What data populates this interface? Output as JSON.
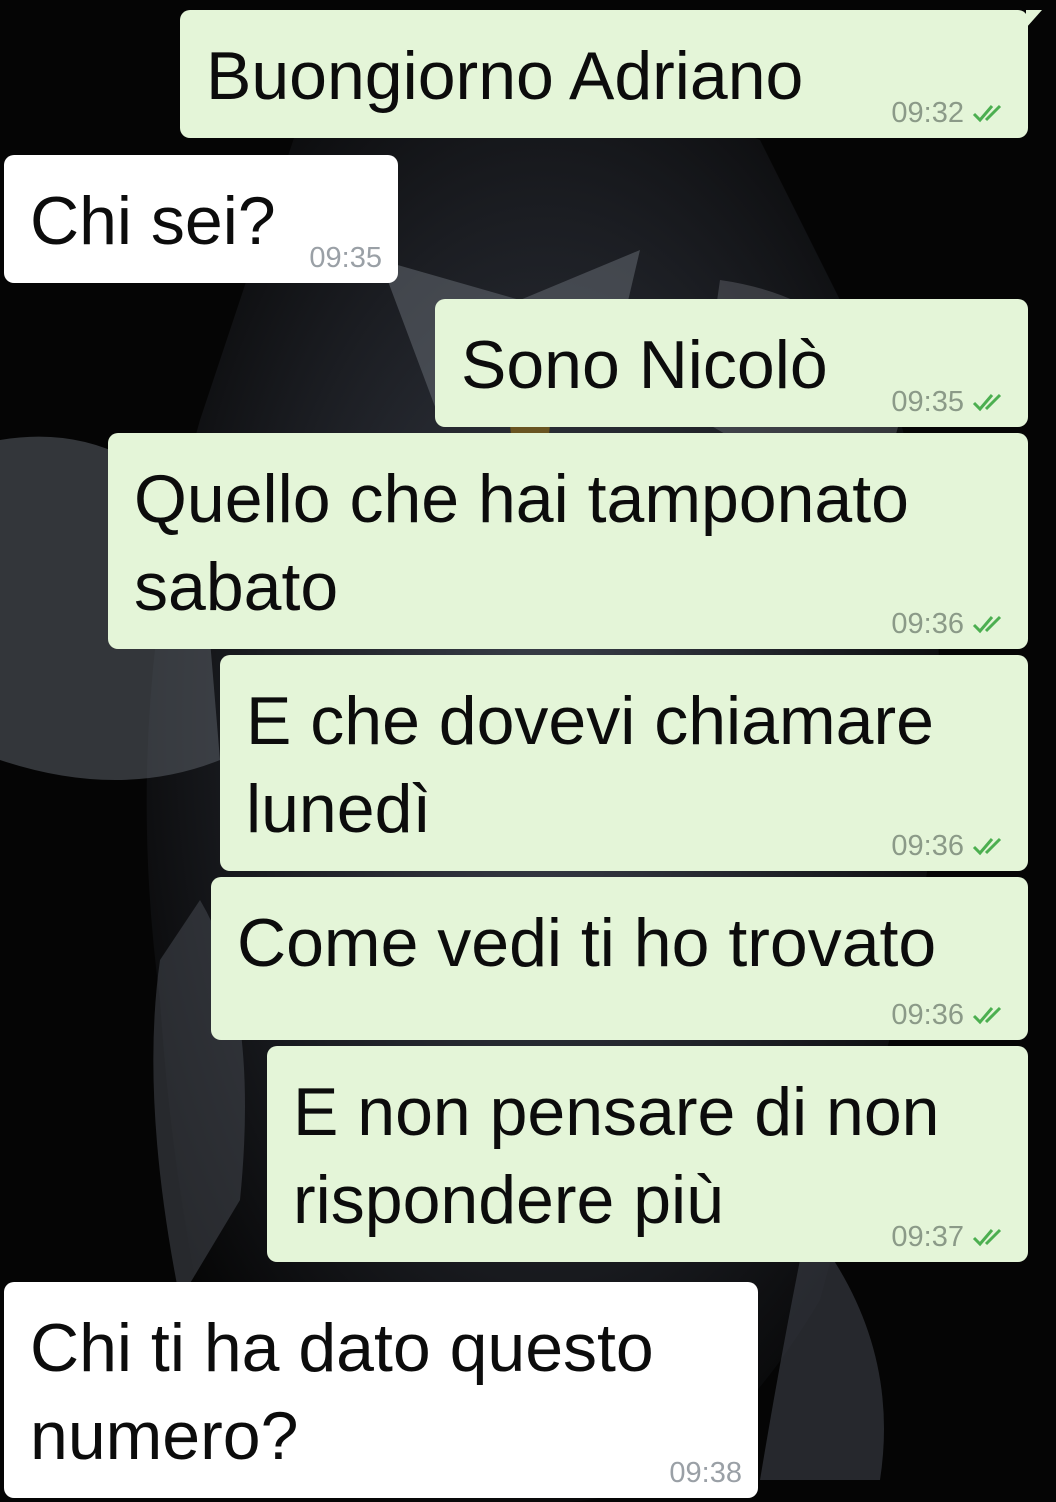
{
  "chat": {
    "messages": [
      {
        "text": "Buongiorno Adriano",
        "time": "09:32",
        "direction": "out",
        "status": "read"
      },
      {
        "text": "Chi sei?",
        "time": "09:35",
        "direction": "in"
      },
      {
        "text": "Sono Nicolò",
        "time": "09:35",
        "direction": "out",
        "status": "read"
      },
      {
        "text": "Quello che hai tamponato\nsabato",
        "time": "09:36",
        "direction": "out",
        "status": "read"
      },
      {
        "text": "E che dovevi chiamare\nlunedì",
        "time": "09:36",
        "direction": "out",
        "status": "read"
      },
      {
        "text": "Come vedi ti ho trovato",
        "time": "09:36",
        "direction": "out",
        "status": "read"
      },
      {
        "text": "E non pensare di non\nrispondere più",
        "time": "09:37",
        "direction": "out",
        "status": "read"
      },
      {
        "text": "Chi ti ha dato questo\nnumero?",
        "time": "09:38",
        "direction": "in"
      }
    ]
  },
  "colors": {
    "outgoing_bubble": "#e4f5d8",
    "incoming_bubble": "#ffffff",
    "read_ticks": "#4caf50",
    "background": "#050505"
  },
  "icons": {
    "read_status": "double-check-icon",
    "wallpaper": "character-figure-wallpaper"
  }
}
